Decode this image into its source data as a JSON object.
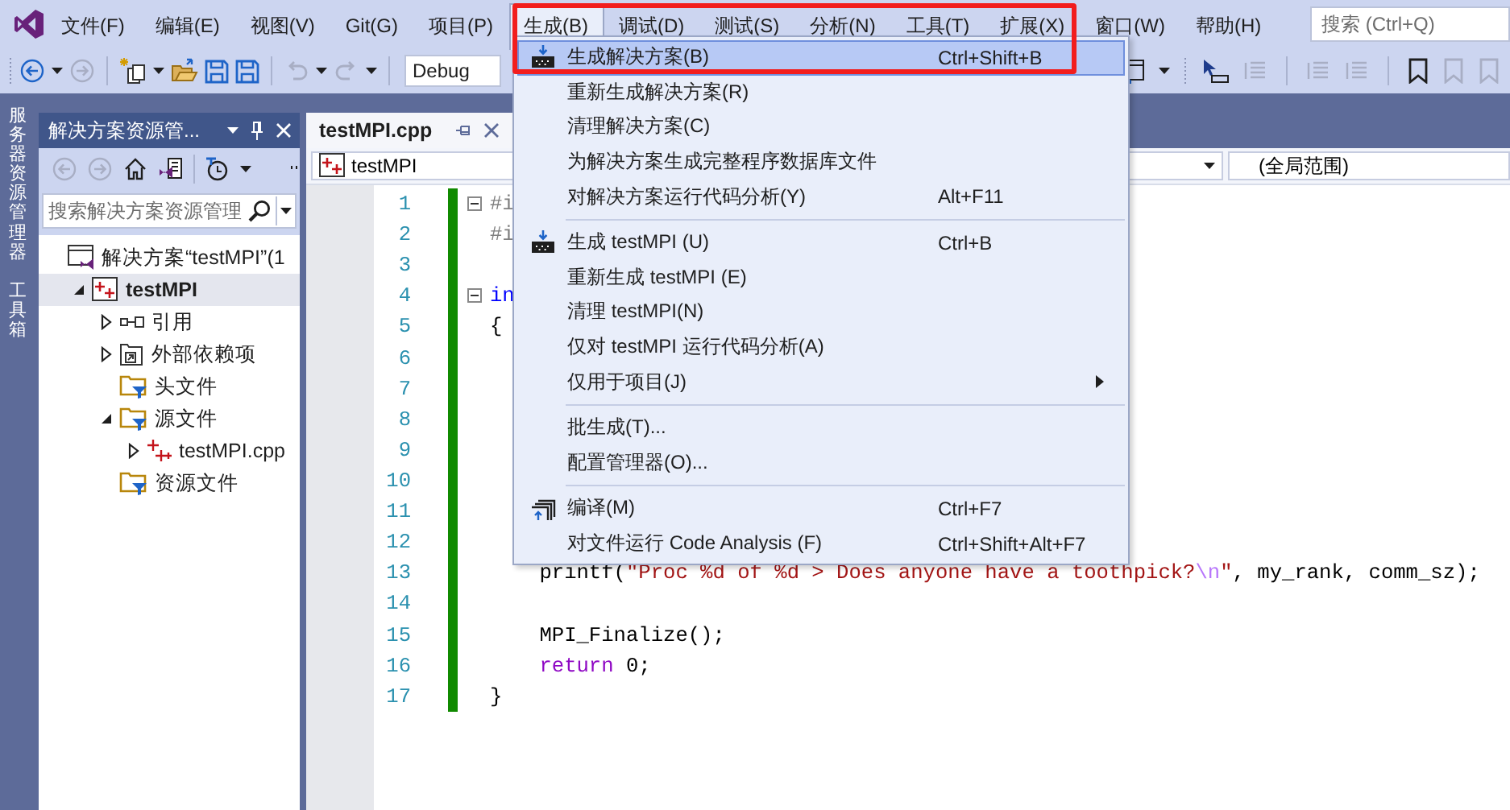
{
  "menubar": {
    "items": [
      {
        "label": "文件(F)",
        "selected": false
      },
      {
        "label": "编辑(E)",
        "selected": false
      },
      {
        "label": "视图(V)",
        "selected": false
      },
      {
        "label": "Git(G)",
        "selected": false
      },
      {
        "label": "项目(P)",
        "selected": false
      },
      {
        "label": "生成(B)",
        "selected": true
      },
      {
        "label": "调试(D)",
        "selected": false
      },
      {
        "label": "测试(S)",
        "selected": false
      },
      {
        "label": "分析(N)",
        "selected": false
      },
      {
        "label": "工具(T)",
        "selected": false
      },
      {
        "label": "扩展(X)",
        "selected": false
      },
      {
        "label": "窗口(W)",
        "selected": false
      },
      {
        "label": "帮助(H)",
        "selected": false
      }
    ],
    "search": {
      "placeholder": "搜索 (Ctrl+Q)"
    }
  },
  "toolbar": {
    "configuration": "Debug"
  },
  "side_strip": {
    "tabs": [
      "服务器资源管理器",
      "工具箱"
    ]
  },
  "solution_explorer": {
    "title": "解决方案资源管...",
    "search": {
      "placeholder": "搜索解决方案资源管理"
    },
    "tree": [
      {
        "label": "解决方案“testMPI”(1",
        "kind": "solution",
        "selected": false,
        "children": [
          {
            "label": "testMPI",
            "kind": "project",
            "selected": true,
            "expanded": true,
            "children": [
              {
                "label": "引用",
                "kind": "references",
                "selected": false,
                "expanded": false
              },
              {
                "label": "外部依赖项",
                "kind": "external",
                "selected": false,
                "expanded": false
              },
              {
                "label": "头文件",
                "kind": "filter",
                "selected": false
              },
              {
                "label": "源文件",
                "kind": "filter",
                "selected": false,
                "expanded": true,
                "children": [
                  {
                    "label": "testMPI.cpp",
                    "kind": "cpp",
                    "selected": false,
                    "expanded": false
                  }
                ]
              },
              {
                "label": "资源文件",
                "kind": "filter",
                "selected": false
              }
            ]
          }
        ]
      }
    ]
  },
  "editor": {
    "tab": {
      "label": "testMPI.cpp"
    },
    "navigation": {
      "scope": "testMPI",
      "member": "(全局范围)"
    },
    "lines": [
      {
        "number": "1",
        "changed": true,
        "expanded": true,
        "tokens": [
          {
            "text": "#i",
            "kind": "preproc"
          }
        ]
      },
      {
        "number": "2",
        "changed": true,
        "tokens": [
          {
            "text": "#i",
            "kind": "preproc"
          }
        ]
      },
      {
        "number": "3",
        "changed": true
      },
      {
        "number": "4",
        "changed": true,
        "expanded": true,
        "tokens": [
          {
            "text": "in",
            "kind": "keyword"
          }
        ]
      },
      {
        "number": "5",
        "changed": true,
        "tokens": [
          {
            "text": "{",
            "kind": "plain"
          }
        ]
      },
      {
        "number": "6",
        "changed": true
      },
      {
        "number": "7",
        "changed": true
      },
      {
        "number": "8",
        "changed": true
      },
      {
        "number": "9",
        "changed": true
      },
      {
        "number": "10",
        "changed": true
      },
      {
        "number": "11",
        "changed": true
      },
      {
        "number": "12",
        "changed": true
      },
      {
        "number": "13",
        "changed": true,
        "tokens": [
          {
            "text": "    printf(",
            "kind": "plain"
          },
          {
            "text": "\"Proc %d of %d > Does anyone have a toothpick?",
            "kind": "string"
          },
          {
            "text": "\\n",
            "kind": "escape"
          },
          {
            "text": "\"",
            "kind": "string"
          },
          {
            "text": ", my_rank, comm_sz);",
            "kind": "plain"
          }
        ]
      },
      {
        "number": "14",
        "changed": true
      },
      {
        "number": "15",
        "changed": true,
        "tokens": [
          {
            "text": "    MPI_Finalize();",
            "kind": "plain"
          }
        ]
      },
      {
        "number": "16",
        "changed": true,
        "tokens": [
          {
            "text": "    return",
            "kind": "control"
          },
          {
            "text": " 0;",
            "kind": "plain"
          }
        ]
      },
      {
        "number": "17",
        "changed": true,
        "tokens": [
          {
            "text": "}",
            "kind": "plain"
          }
        ]
      }
    ]
  },
  "build_menu": {
    "items": [
      {
        "kind": "build",
        "label": "生成解决方案(B)",
        "shortcut": "Ctrl+Shift+B",
        "selected": true
      },
      {
        "kind": "command",
        "label": "重新生成解决方案(R)",
        "selected": false
      },
      {
        "kind": "command",
        "label": "清理解决方案(C)",
        "selected": false
      },
      {
        "kind": "command",
        "label": "为解决方案生成完整程序数据库文件",
        "selected": false
      },
      {
        "kind": "command",
        "label": "对解决方案运行代码分析(Y)",
        "shortcut": "Alt+F11",
        "selected": false
      },
      {
        "kind": "separator"
      },
      {
        "kind": "build",
        "label": "生成 testMPI (U)",
        "shortcut": "Ctrl+B",
        "selected": false
      },
      {
        "kind": "command",
        "label": "重新生成 testMPI (E)",
        "selected": false
      },
      {
        "kind": "command",
        "label": "清理 testMPI(N)",
        "selected": false
      },
      {
        "kind": "command",
        "label": "仅对 testMPI 运行代码分析(A)",
        "selected": false
      },
      {
        "kind": "submenu",
        "label": "仅用于项目(J)",
        "selected": false
      },
      {
        "kind": "separator"
      },
      {
        "kind": "command",
        "label": "批生成(T)...",
        "selected": false
      },
      {
        "kind": "command",
        "label": "配置管理器(O)...",
        "selected": false
      },
      {
        "kind": "separator"
      },
      {
        "kind": "compile",
        "label": "编译(M)",
        "shortcut": "Ctrl+F7",
        "selected": false
      },
      {
        "kind": "command",
        "label": "对文件运行 Code Analysis (F)",
        "shortcut": "Ctrl+Shift+Alt+F7",
        "selected": false
      }
    ]
  }
}
